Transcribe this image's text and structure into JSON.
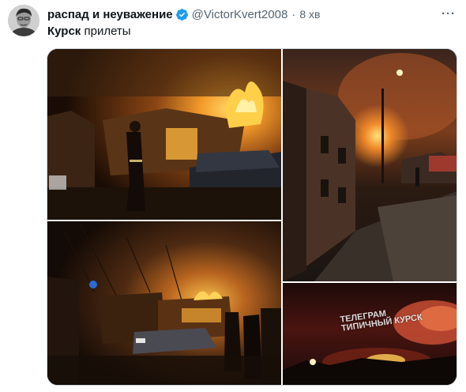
{
  "tweet": {
    "display_name": "распад и неуважение",
    "handle": "@VictorKvert2008",
    "separator": "·",
    "time": "8 хв",
    "more_label": "···",
    "text_hashtag": "Курск",
    "text_body": " прилеты",
    "verified_color": "#1d9bf0"
  },
  "media": {
    "photos": [
      {
        "alt_name": "burning-house-firefighter-photo"
      },
      {
        "alt_name": "street-fire-buildings-photo"
      },
      {
        "alt_name": "burning-house-firefighters-car-photo"
      },
      {
        "alt_name": "night-fire-glow-photo"
      }
    ],
    "watermark_line1": "ТЕЛЕГРАМ",
    "watermark_line2": "ТИПИЧНЫЙ КУРСК"
  }
}
